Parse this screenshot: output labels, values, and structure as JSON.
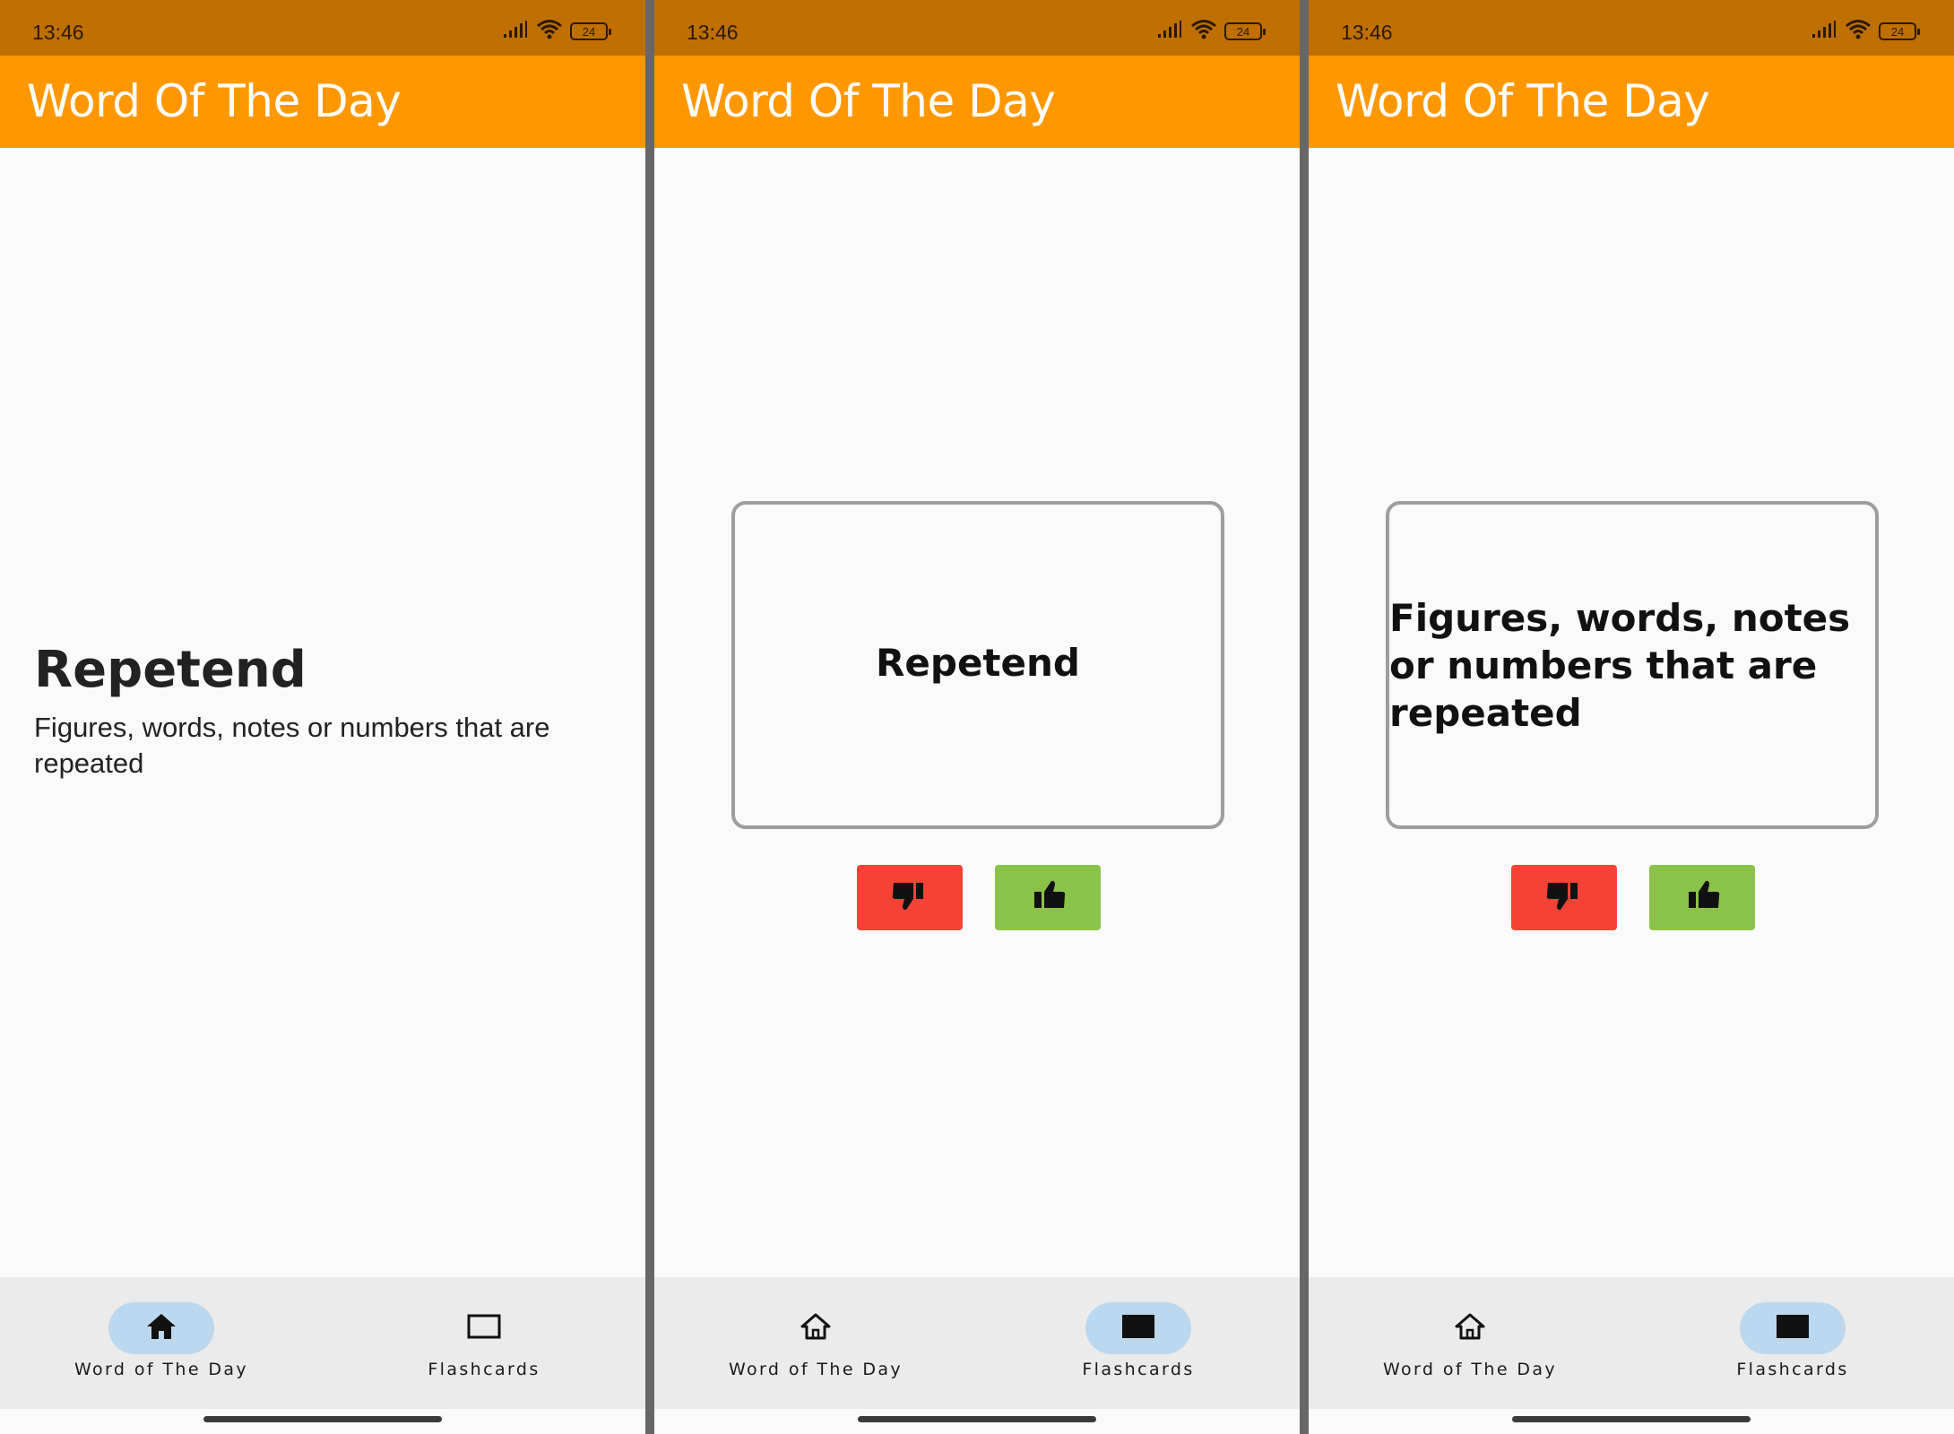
{
  "status_bar": {
    "time": "13:46",
    "battery": "24"
  },
  "app_title": "Word Of The Day",
  "word": {
    "term": "Repetend",
    "definition": "Figures, words, notes or numbers that are repeated"
  },
  "nav": {
    "word_of_day_label": "Word of The Day",
    "flashcards_label": "Flashcards"
  },
  "screens": [
    {
      "active_tab": "Word of The Day",
      "view": "word"
    },
    {
      "active_tab": "Flashcards",
      "view": "flashcard-front"
    },
    {
      "active_tab": "Flashcards",
      "view": "flashcard-back"
    }
  ],
  "colors": {
    "status_bar": "#bf6f00",
    "app_bar": "#ff9800",
    "dislike_button": "#f44336",
    "like_button": "#8bc34a",
    "active_tab_pill": "#bcd8ef"
  },
  "icons": {
    "home": "home-icon",
    "flashcards": "flashcard-icon",
    "dislike": "thumbs-down-icon",
    "like": "thumbs-up-icon",
    "signal": "signal-icon",
    "wifi": "wifi-icon",
    "battery": "battery-icon"
  }
}
